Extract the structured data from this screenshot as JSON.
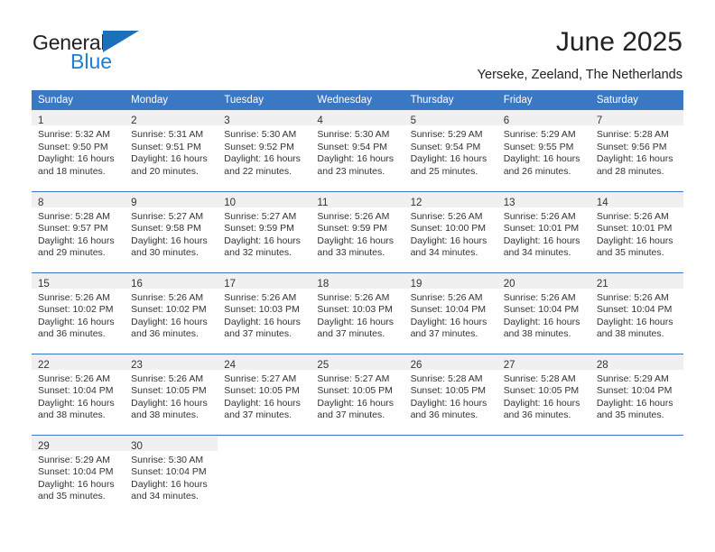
{
  "brand": {
    "name_part1": "General",
    "name_part2": "Blue",
    "triangle_color": "#1c6fba"
  },
  "header": {
    "title": "June 2025",
    "subtitle": "Yerseke, Zeeland, The Netherlands"
  },
  "theme": {
    "header_blue": "#3b78c3",
    "daynum_band": "#f0f0f0",
    "text": "#333333"
  },
  "weekdays": [
    "Sunday",
    "Monday",
    "Tuesday",
    "Wednesday",
    "Thursday",
    "Friday",
    "Saturday"
  ],
  "weeks": [
    [
      {
        "day": "1",
        "sunrise": "Sunrise: 5:32 AM",
        "sunset": "Sunset: 9:50 PM",
        "daylight": "Daylight: 16 hours and 18 minutes."
      },
      {
        "day": "2",
        "sunrise": "Sunrise: 5:31 AM",
        "sunset": "Sunset: 9:51 PM",
        "daylight": "Daylight: 16 hours and 20 minutes."
      },
      {
        "day": "3",
        "sunrise": "Sunrise: 5:30 AM",
        "sunset": "Sunset: 9:52 PM",
        "daylight": "Daylight: 16 hours and 22 minutes."
      },
      {
        "day": "4",
        "sunrise": "Sunrise: 5:30 AM",
        "sunset": "Sunset: 9:54 PM",
        "daylight": "Daylight: 16 hours and 23 minutes."
      },
      {
        "day": "5",
        "sunrise": "Sunrise: 5:29 AM",
        "sunset": "Sunset: 9:54 PM",
        "daylight": "Daylight: 16 hours and 25 minutes."
      },
      {
        "day": "6",
        "sunrise": "Sunrise: 5:29 AM",
        "sunset": "Sunset: 9:55 PM",
        "daylight": "Daylight: 16 hours and 26 minutes."
      },
      {
        "day": "7",
        "sunrise": "Sunrise: 5:28 AM",
        "sunset": "Sunset: 9:56 PM",
        "daylight": "Daylight: 16 hours and 28 minutes."
      }
    ],
    [
      {
        "day": "8",
        "sunrise": "Sunrise: 5:28 AM",
        "sunset": "Sunset: 9:57 PM",
        "daylight": "Daylight: 16 hours and 29 minutes."
      },
      {
        "day": "9",
        "sunrise": "Sunrise: 5:27 AM",
        "sunset": "Sunset: 9:58 PM",
        "daylight": "Daylight: 16 hours and 30 minutes."
      },
      {
        "day": "10",
        "sunrise": "Sunrise: 5:27 AM",
        "sunset": "Sunset: 9:59 PM",
        "daylight": "Daylight: 16 hours and 32 minutes."
      },
      {
        "day": "11",
        "sunrise": "Sunrise: 5:26 AM",
        "sunset": "Sunset: 9:59 PM",
        "daylight": "Daylight: 16 hours and 33 minutes."
      },
      {
        "day": "12",
        "sunrise": "Sunrise: 5:26 AM",
        "sunset": "Sunset: 10:00 PM",
        "daylight": "Daylight: 16 hours and 34 minutes."
      },
      {
        "day": "13",
        "sunrise": "Sunrise: 5:26 AM",
        "sunset": "Sunset: 10:01 PM",
        "daylight": "Daylight: 16 hours and 34 minutes."
      },
      {
        "day": "14",
        "sunrise": "Sunrise: 5:26 AM",
        "sunset": "Sunset: 10:01 PM",
        "daylight": "Daylight: 16 hours and 35 minutes."
      }
    ],
    [
      {
        "day": "15",
        "sunrise": "Sunrise: 5:26 AM",
        "sunset": "Sunset: 10:02 PM",
        "daylight": "Daylight: 16 hours and 36 minutes."
      },
      {
        "day": "16",
        "sunrise": "Sunrise: 5:26 AM",
        "sunset": "Sunset: 10:02 PM",
        "daylight": "Daylight: 16 hours and 36 minutes."
      },
      {
        "day": "17",
        "sunrise": "Sunrise: 5:26 AM",
        "sunset": "Sunset: 10:03 PM",
        "daylight": "Daylight: 16 hours and 37 minutes."
      },
      {
        "day": "18",
        "sunrise": "Sunrise: 5:26 AM",
        "sunset": "Sunset: 10:03 PM",
        "daylight": "Daylight: 16 hours and 37 minutes."
      },
      {
        "day": "19",
        "sunrise": "Sunrise: 5:26 AM",
        "sunset": "Sunset: 10:04 PM",
        "daylight": "Daylight: 16 hours and 37 minutes."
      },
      {
        "day": "20",
        "sunrise": "Sunrise: 5:26 AM",
        "sunset": "Sunset: 10:04 PM",
        "daylight": "Daylight: 16 hours and 38 minutes."
      },
      {
        "day": "21",
        "sunrise": "Sunrise: 5:26 AM",
        "sunset": "Sunset: 10:04 PM",
        "daylight": "Daylight: 16 hours and 38 minutes."
      }
    ],
    [
      {
        "day": "22",
        "sunrise": "Sunrise: 5:26 AM",
        "sunset": "Sunset: 10:04 PM",
        "daylight": "Daylight: 16 hours and 38 minutes."
      },
      {
        "day": "23",
        "sunrise": "Sunrise: 5:26 AM",
        "sunset": "Sunset: 10:05 PM",
        "daylight": "Daylight: 16 hours and 38 minutes."
      },
      {
        "day": "24",
        "sunrise": "Sunrise: 5:27 AM",
        "sunset": "Sunset: 10:05 PM",
        "daylight": "Daylight: 16 hours and 37 minutes."
      },
      {
        "day": "25",
        "sunrise": "Sunrise: 5:27 AM",
        "sunset": "Sunset: 10:05 PM",
        "daylight": "Daylight: 16 hours and 37 minutes."
      },
      {
        "day": "26",
        "sunrise": "Sunrise: 5:28 AM",
        "sunset": "Sunset: 10:05 PM",
        "daylight": "Daylight: 16 hours and 36 minutes."
      },
      {
        "day": "27",
        "sunrise": "Sunrise: 5:28 AM",
        "sunset": "Sunset: 10:05 PM",
        "daylight": "Daylight: 16 hours and 36 minutes."
      },
      {
        "day": "28",
        "sunrise": "Sunrise: 5:29 AM",
        "sunset": "Sunset: 10:04 PM",
        "daylight": "Daylight: 16 hours and 35 minutes."
      }
    ],
    [
      {
        "day": "29",
        "sunrise": "Sunrise: 5:29 AM",
        "sunset": "Sunset: 10:04 PM",
        "daylight": "Daylight: 16 hours and 35 minutes."
      },
      {
        "day": "30",
        "sunrise": "Sunrise: 5:30 AM",
        "sunset": "Sunset: 10:04 PM",
        "daylight": "Daylight: 16 hours and 34 minutes."
      },
      {
        "day": "",
        "sunrise": "",
        "sunset": "",
        "daylight": ""
      },
      {
        "day": "",
        "sunrise": "",
        "sunset": "",
        "daylight": ""
      },
      {
        "day": "",
        "sunrise": "",
        "sunset": "",
        "daylight": ""
      },
      {
        "day": "",
        "sunrise": "",
        "sunset": "",
        "daylight": ""
      },
      {
        "day": "",
        "sunrise": "",
        "sunset": "",
        "daylight": ""
      }
    ]
  ]
}
